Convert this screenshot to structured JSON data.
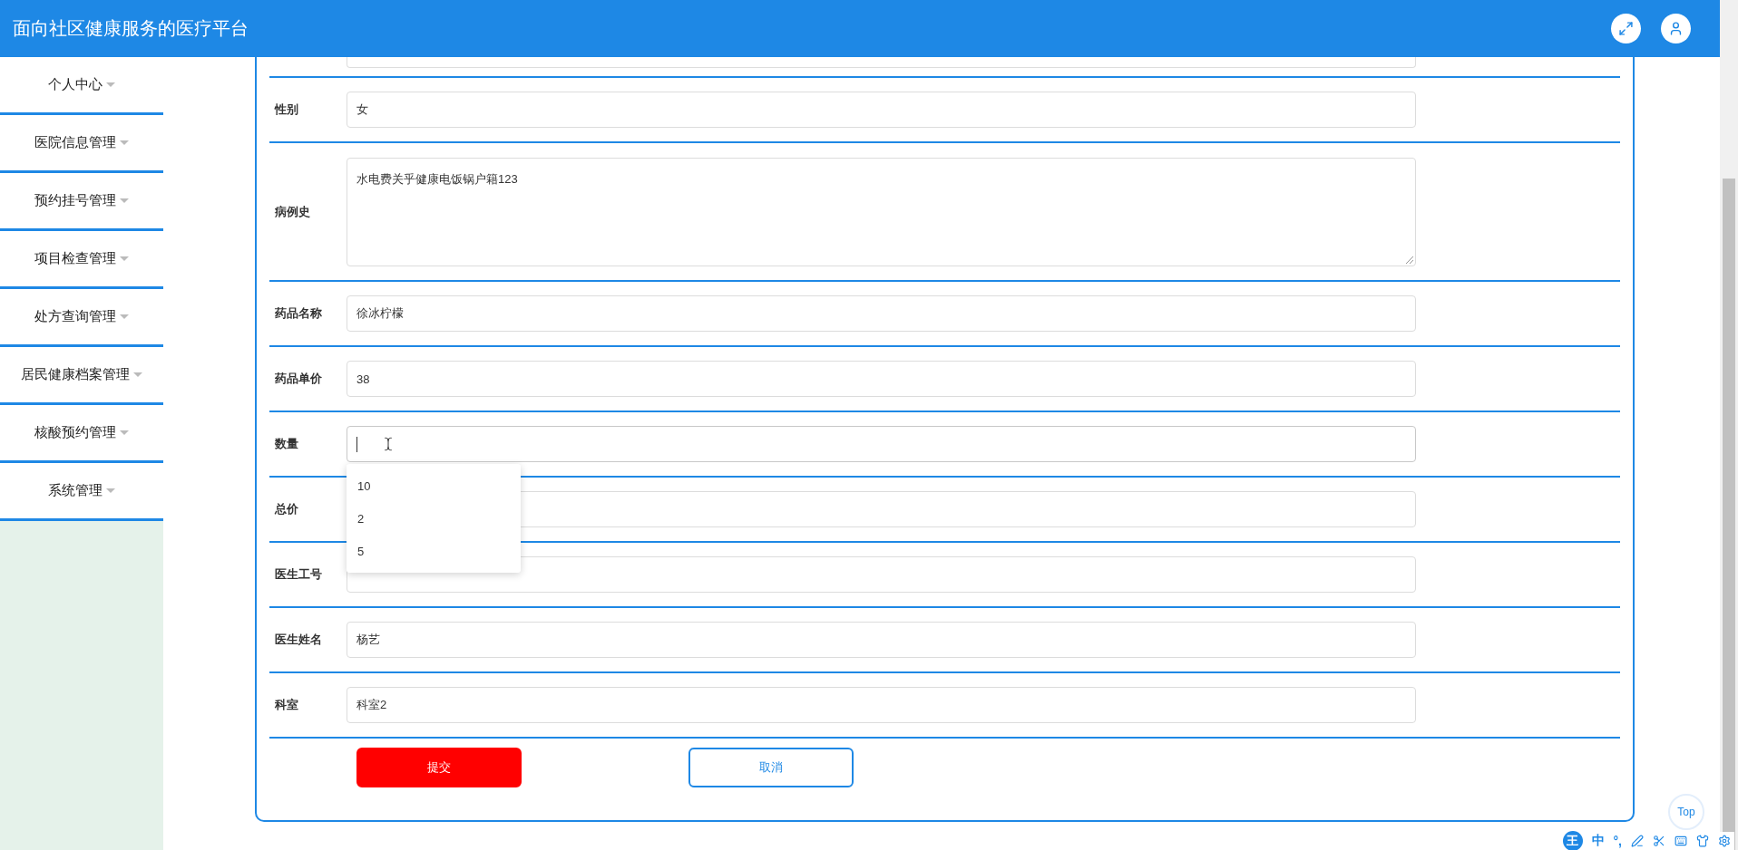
{
  "header": {
    "title": "面向社区健康服务的医疗平台",
    "buttons": [
      {
        "kind": "fullscreen"
      },
      {
        "kind": "user"
      }
    ]
  },
  "sidebar": {
    "items": [
      {
        "label": "个人中心"
      },
      {
        "label": "医院信息管理"
      },
      {
        "label": "预约挂号管理"
      },
      {
        "label": "项目检查管理"
      },
      {
        "label": "处方查询管理"
      },
      {
        "label": "居民健康档案管理"
      },
      {
        "label": "核酸预约管理"
      },
      {
        "label": "系统管理"
      }
    ]
  },
  "form": {
    "fields": [
      {
        "kind": "partial"
      },
      {
        "kind": "input",
        "label": "性别",
        "value": "女",
        "focused": false
      },
      {
        "kind": "textarea",
        "label": "病例史",
        "value": "水电费关乎健康电饭锅户籍123",
        "focused": false
      },
      {
        "kind": "input",
        "label": "药品名称",
        "value": "徐冰柠檬",
        "focused": false
      },
      {
        "kind": "input",
        "label": "药品单价",
        "value": "38",
        "focused": false
      },
      {
        "kind": "input",
        "label": "数量",
        "focused": true,
        "suggestions": [
          "10",
          "2",
          "5"
        ]
      },
      {
        "kind": "input",
        "label": "总价",
        "focused": false
      },
      {
        "kind": "input",
        "label": "医生工号",
        "focused": false
      },
      {
        "kind": "input",
        "label": "医生姓名",
        "value": "杨艺",
        "focused": false
      },
      {
        "kind": "input",
        "label": "科室",
        "value": "科室2",
        "focused": false
      }
    ],
    "buttons": [
      {
        "kind": "primary",
        "label": "提交"
      },
      {
        "kind": "secondary",
        "label": "取消"
      }
    ]
  },
  "back_to_top": "Top",
  "ime_toolbar": {
    "logo": "王",
    "mode": "中",
    "punctuation": "°,"
  }
}
